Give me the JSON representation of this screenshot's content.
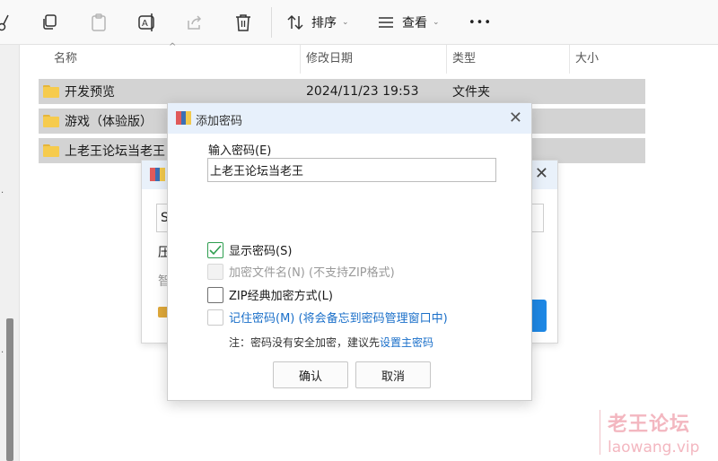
{
  "toolbar": {
    "sort_label": "排序",
    "view_label": "查看",
    "more_label": "•••"
  },
  "columns": {
    "name": "名称",
    "modified": "修改日期",
    "type": "类型",
    "size": "大小"
  },
  "files": [
    {
      "name": "开发预览",
      "modified": "2024/11/23 19:53",
      "type": "文件夹"
    },
    {
      "name": "游戏（体验版）",
      "modified": "",
      "type": ""
    },
    {
      "name": "上老王论坛当老王",
      "modified": "",
      "type": ""
    }
  ],
  "background_dialog": {
    "input_prefix": "S",
    "label_1": "压",
    "label_2": "智"
  },
  "dialog": {
    "title": "添加密码",
    "password_label": "输入密码(E)",
    "password_value": "上老王论坛当老王",
    "options": {
      "show_password": {
        "label": "显示密码(S)",
        "checked": true
      },
      "encrypt_filenames": {
        "label": "加密文件名(N) (不支持ZIP格式)",
        "checked": false,
        "disabled": true
      },
      "zip_legacy": {
        "label": "ZIP经典加密方式(L)",
        "checked": false
      },
      "remember_password": {
        "label": "记住密码(M) (将会备忘到密码管理窗口中)",
        "checked": false
      }
    },
    "note_prefix": "注：密码没有安全加密，建议先",
    "note_link": "设置主密码",
    "ok_label": "确认",
    "cancel_label": "取消"
  },
  "watermark": {
    "cn": "老王论坛",
    "en": "laowang.vip"
  },
  "colors": {
    "dialog_title_bg": "#e7f0fb",
    "selected_row": "#d3d3d3",
    "link": "#1a6fc9",
    "checkbox_checked": "#2e9e4f",
    "watermark": "#f3b7c0"
  }
}
